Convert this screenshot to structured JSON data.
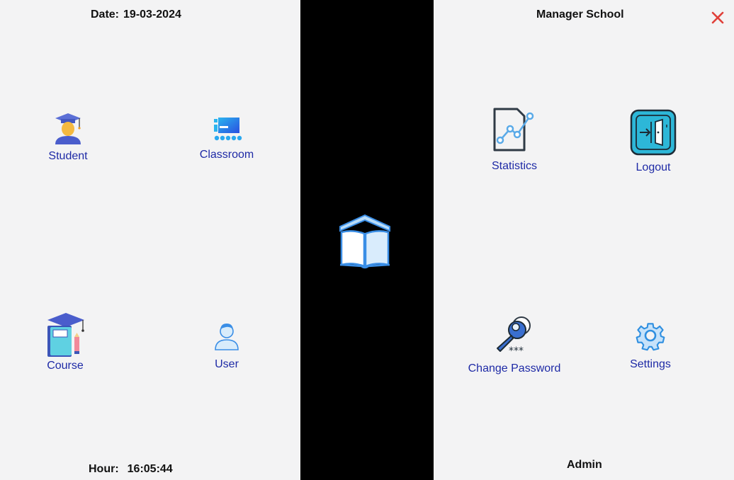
{
  "left_panel": {
    "date_label": "Date:",
    "date_value": "19-03-2024",
    "hour_label": "Hour:",
    "hour_value": "16:05:44",
    "tiles": [
      {
        "label": "Student",
        "icon": "student-graduate-icon"
      },
      {
        "label": "Classroom",
        "icon": "classroom-icon"
      },
      {
        "label": "Course",
        "icon": "course-books-icon"
      },
      {
        "label": "User",
        "icon": "user-icon"
      }
    ]
  },
  "center": {
    "logo_icon": "open-book-logo-icon"
  },
  "right_panel": {
    "title": "Manager School",
    "close_icon": "close-x-icon",
    "footer_user": "Admin",
    "tiles": [
      {
        "label": "Statistics",
        "icon": "statistics-chart-icon"
      },
      {
        "label": "Logout",
        "icon": "logout-door-icon"
      },
      {
        "label": "Change Password",
        "icon": "key-password-icon"
      },
      {
        "label": "Settings",
        "icon": "gear-icon"
      }
    ]
  },
  "colors": {
    "panel_bg": "#f3f3f4",
    "separator_bg": "#000000",
    "tile_label": "#1e2aa6",
    "close_red": "#e0403a",
    "accent_blue": "#3a8ee6"
  }
}
